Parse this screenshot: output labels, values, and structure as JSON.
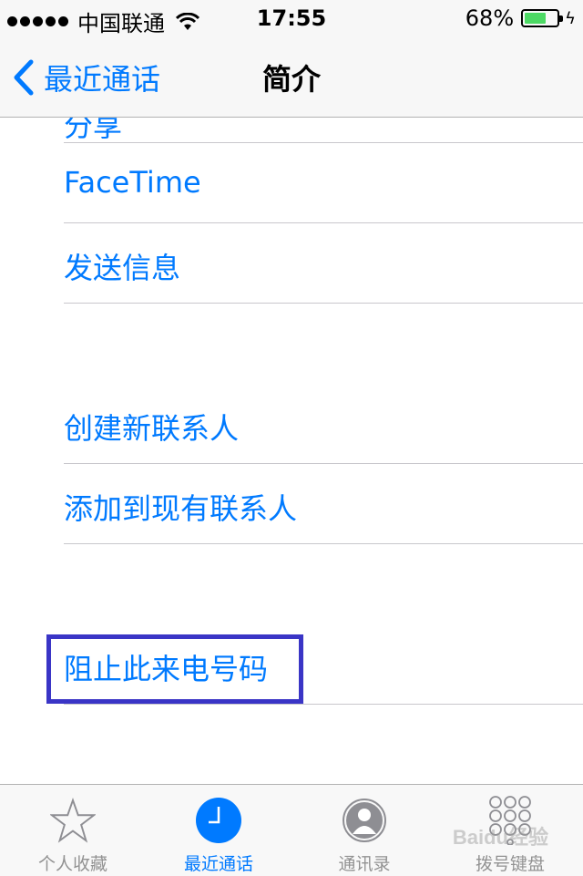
{
  "status_bar": {
    "carrier": "中国联通",
    "time": "17:55",
    "battery_percent": "68%",
    "battery_level": 0.68,
    "charging": true
  },
  "nav": {
    "back_label": "最近通话",
    "title": "简介"
  },
  "rows": {
    "partial_label": "分享",
    "facetime": "FaceTime",
    "send_message": "发送信息",
    "create_contact": "创建新联系人",
    "add_to_existing": "添加到现有联系人",
    "block_caller": "阻止此来电号码"
  },
  "tab_bar": {
    "tabs": [
      {
        "label": "个人收藏",
        "icon": "star-icon",
        "active": false
      },
      {
        "label": "最近通话",
        "icon": "clock-icon",
        "active": true
      },
      {
        "label": "通讯录",
        "icon": "contact-icon",
        "active": false
      },
      {
        "label": "拨号键盘",
        "icon": "keypad-icon",
        "active": false
      }
    ]
  },
  "watermark": "Baidu经验",
  "colors": {
    "accent": "#007aff",
    "highlight_border": "#3a35c6",
    "battery": "#4cd964"
  }
}
